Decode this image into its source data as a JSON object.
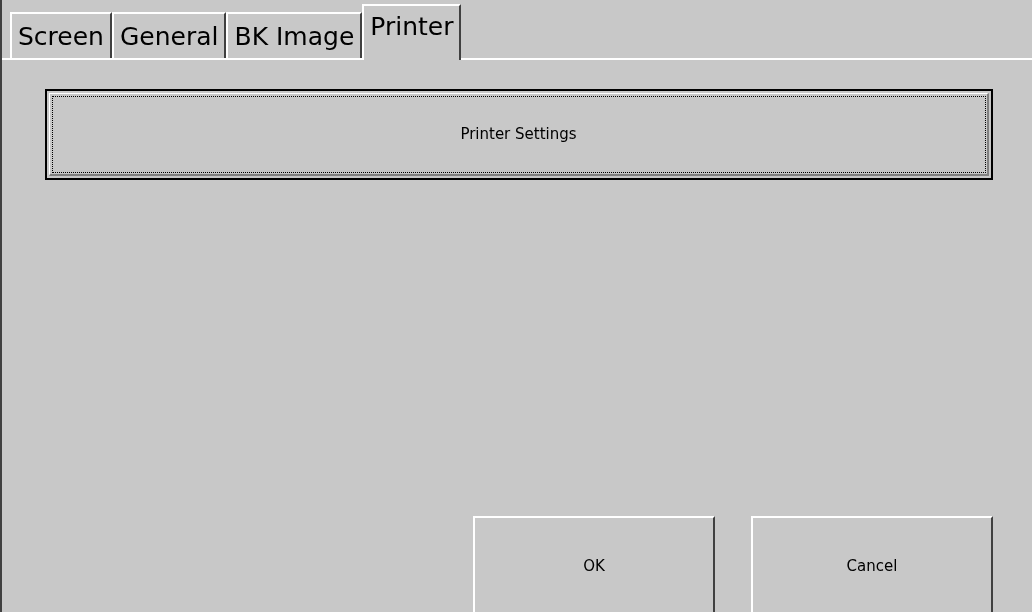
{
  "tabs": [
    {
      "label": "Screen",
      "selected": false
    },
    {
      "label": "General",
      "selected": false
    },
    {
      "label": "BK Image",
      "selected": false
    },
    {
      "label": "Printer",
      "selected": true
    }
  ],
  "settings_button": {
    "label": "Printer Settings",
    "focused": true
  },
  "buttons": [
    {
      "label": "OK"
    },
    {
      "label": "Cancel"
    }
  ]
}
